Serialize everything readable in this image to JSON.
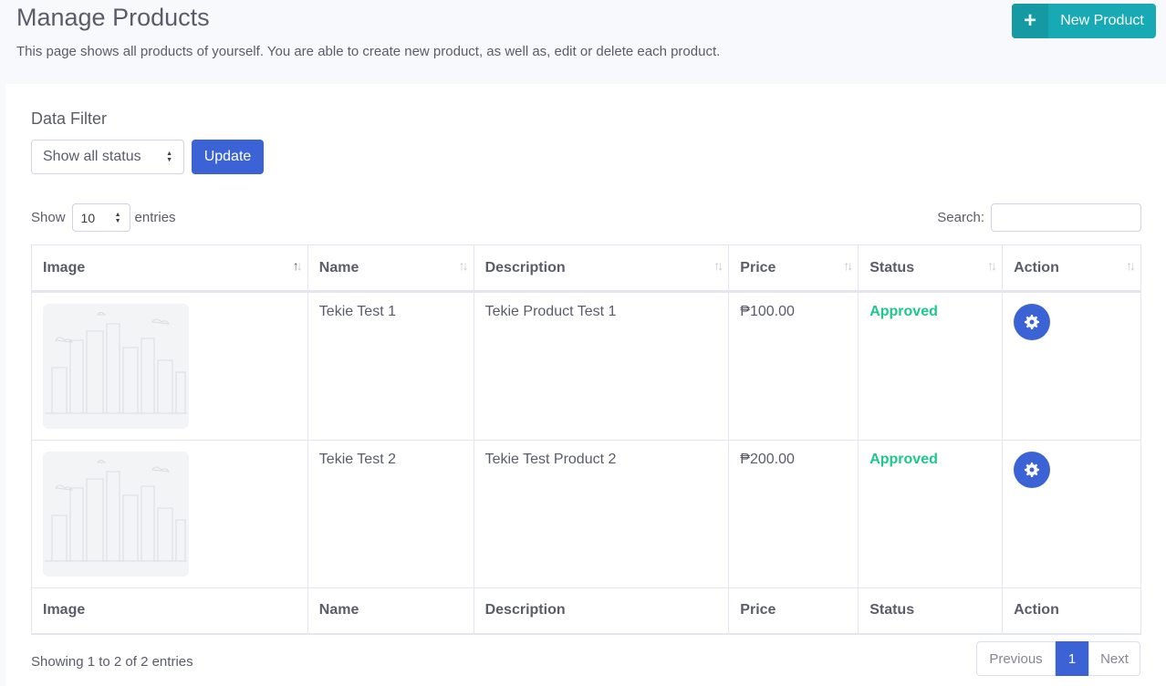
{
  "header": {
    "title": "Manage Products",
    "description": "This page shows all products of yourself. You are able to create new product, as well as, edit or delete each product.",
    "new_button": {
      "icon": "+",
      "label": "New Product"
    }
  },
  "filter": {
    "title": "Data Filter",
    "status_select": "Show all status",
    "update_label": "Update"
  },
  "table_controls": {
    "show_label": "Show",
    "entries_value": "10",
    "entries_label": "entries",
    "search_label": "Search:"
  },
  "columns": [
    "Image",
    "Name",
    "Description",
    "Price",
    "Status",
    "Action"
  ],
  "rows": [
    {
      "name": "Tekie Test 1",
      "description": "Tekie Product Test 1",
      "price": "₱100.00",
      "status": "Approved"
    },
    {
      "name": "Tekie Test 2",
      "description": "Tekie Test Product 2",
      "price": "₱200.00",
      "status": "Approved"
    }
  ],
  "footer": {
    "info": "Showing 1 to 2 of 2 entries",
    "pagination": {
      "previous": "Previous",
      "current": "1",
      "next": "Next"
    }
  },
  "colors": {
    "primary": "#3b63d6",
    "teal": "#17a9b4",
    "success": "#1cc88a"
  }
}
